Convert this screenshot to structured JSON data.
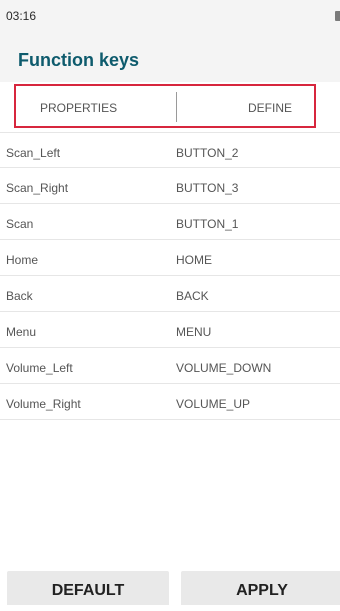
{
  "status_bar": {
    "time": "03:16"
  },
  "app_bar": {
    "title": "Function keys"
  },
  "header": {
    "properties_label": "PROPERTIES",
    "define_label": "DEFINE"
  },
  "rows": [
    {
      "key": "Scan_Left",
      "value": "BUTTON_2"
    },
    {
      "key": "Scan_Right",
      "value": "BUTTON_3"
    },
    {
      "key": "Scan",
      "value": "BUTTON_1"
    },
    {
      "key": "Home",
      "value": "HOME"
    },
    {
      "key": "Back",
      "value": "BACK"
    },
    {
      "key": "Menu",
      "value": "MENU"
    },
    {
      "key": "Volume_Left",
      "value": "VOLUME_DOWN"
    },
    {
      "key": "Volume_Right",
      "value": "VOLUME_UP"
    }
  ],
  "buttons": {
    "default_label": "DEFAULT",
    "apply_label": "APPLY"
  },
  "colors": {
    "title": "#0e5b6d",
    "highlight_border": "#d7263d",
    "bar_background": "#f4f4f4"
  }
}
